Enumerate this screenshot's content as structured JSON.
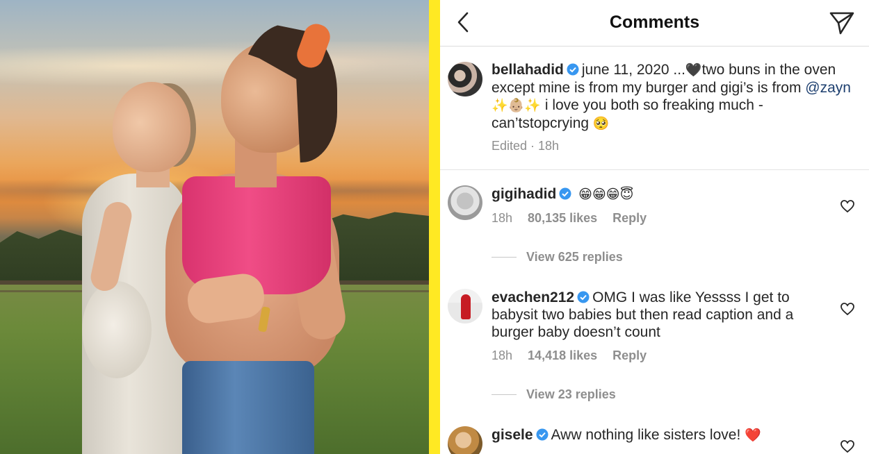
{
  "header": {
    "title": "Comments",
    "back_icon": "chevron-left-icon",
    "send_icon": "paper-plane-icon"
  },
  "post": {
    "username": "bellahadid",
    "caption_line1": "june 11, 2020 ...",
    "caption_heart": "🖤",
    "caption_after_heart": "two buns in the oven except mine is from my burger and gigi’s is from",
    "mention": "@zayn",
    "caption_emojis": "✨👶🏼✨",
    "caption_rest": " i love you both so freaking much -can’tstopcrying ",
    "caption_end_emoji": "🥺",
    "meta": "Edited · 18h"
  },
  "comments": [
    {
      "username": "gigihadid",
      "text": "😁😁😁😇",
      "time": "18h",
      "likes": "80,135 likes",
      "reply": "Reply",
      "view_replies": "View 625 replies"
    },
    {
      "username": "evachen212",
      "text": "OMG I was like Yessss I get to babysit two babies but then read caption and a burger baby doesn’t count",
      "time": "18h",
      "likes": "14,418 likes",
      "reply": "Reply",
      "view_replies": "View 23 replies"
    },
    {
      "username": "gisele",
      "text": "Aww nothing like sisters love! ",
      "emoji": "❤️"
    }
  ],
  "colors": {
    "divider": "#ffe923",
    "verified": "#3897f0",
    "mention": "#1d3f6f",
    "muted": "#8e8e8e"
  }
}
